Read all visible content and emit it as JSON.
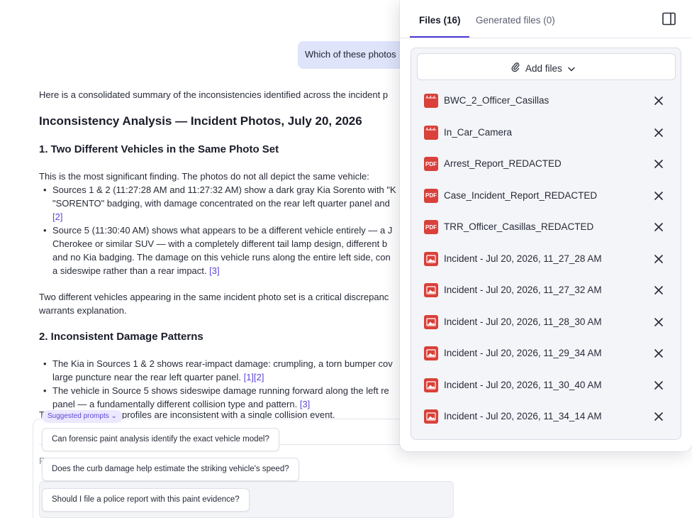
{
  "chat": {
    "user_message": "Which of these photos",
    "intro": "Here is a consolidated summary of the inconsistencies identified across the incident p",
    "heading": "Inconsistency Analysis — Incident Photos, July 20, 2026",
    "section1": {
      "title": "1. Two Different Vehicles in the Same Photo Set",
      "lead": "This is the most significant finding. The photos do not all depict the same vehicle:",
      "b1_l1": "Sources 1 & 2 (11:27:28 AM and 11:27:32 AM) show a dark gray Kia Sorento with \"K",
      "b1_l2": "\"SORENTO\" badging, with damage concentrated on the rear left quarter panel and",
      "b1_cite": "[2]",
      "b2_l1": "Source 5 (11:30:40 AM) shows what appears to be a different vehicle entirely — a J",
      "b2_l2": "Cherokee or similar SUV — with a completely different tail lamp design, different b",
      "b2_l3": "and no Kia badging. The damage on this vehicle runs along the entire left side, con",
      "b2_l4": "a sideswipe rather than a rear impact.",
      "b2_cite": "[3]",
      "after_l1": "Two different vehicles appearing in the same incident photo set is a critical discrepanc",
      "after_l2": "warrants explanation."
    },
    "section2": {
      "title": "2. Inconsistent Damage Patterns",
      "b1_l1": "The Kia in Sources 1 & 2 shows rear-impact damage: crumpling, a torn bumper cov",
      "b1_l2": "large puncture near the rear left quarter panel.",
      "b1_cite": "[1][2]",
      "b2_l1": "The vehicle in Source 5 shows sideswipe damage running forward along the left re",
      "b2_l2": "panel — a fundamentally different collision type and pattern.",
      "b2_cite": "[3]",
      "cut_T": "T",
      "cut_profiles": "profiles are inconsistent with a single collision event.",
      "cut_R": "R"
    }
  },
  "suggestions": {
    "chip_label": "Suggested prompts",
    "items": [
      "Can forensic paint analysis identify the exact vehicle model?",
      "Does the curb damage help estimate the striking vehicle's speed?",
      "Should I file a police report with this paint evidence?"
    ]
  },
  "panel": {
    "tab_files": "Files (16)",
    "tab_generated": "Generated files (0)",
    "add_files": "Add files",
    "files": [
      {
        "name": "BWC_2_Officer_Casillas",
        "type": "video-icon"
      },
      {
        "name": "In_Car_Camera",
        "type": "video-icon"
      },
      {
        "name": "Arrest_Report_REDACTED",
        "type": "pdf-icon"
      },
      {
        "name": "Case_Incident_Report_REDACTED",
        "type": "pdf-icon"
      },
      {
        "name": "TRR_Officer_Casillas_REDACTED",
        "type": "pdf-icon"
      },
      {
        "name": "Incident - Jul 20, 2026, 11_27_28 AM",
        "type": "image-icon"
      },
      {
        "name": "Incident - Jul 20, 2026, 11_27_32 AM",
        "type": "image-icon"
      },
      {
        "name": "Incident - Jul 20, 2026, 11_28_30 AM",
        "type": "image-icon"
      },
      {
        "name": "Incident - Jul 20, 2026, 11_29_34 AM",
        "type": "image-icon"
      },
      {
        "name": "Incident - Jul 20, 2026, 11_30_40 AM",
        "type": "image-icon"
      },
      {
        "name": "Incident - Jul 20, 2026, 11_34_14 AM",
        "type": "image-icon"
      }
    ],
    "pdf_icon_text": "PDF"
  },
  "colors": {
    "accent": "#4b3bd0",
    "citation": "#5b47d6",
    "file_icon_red": "#d9413a",
    "bubble": "#dfe4fb"
  }
}
